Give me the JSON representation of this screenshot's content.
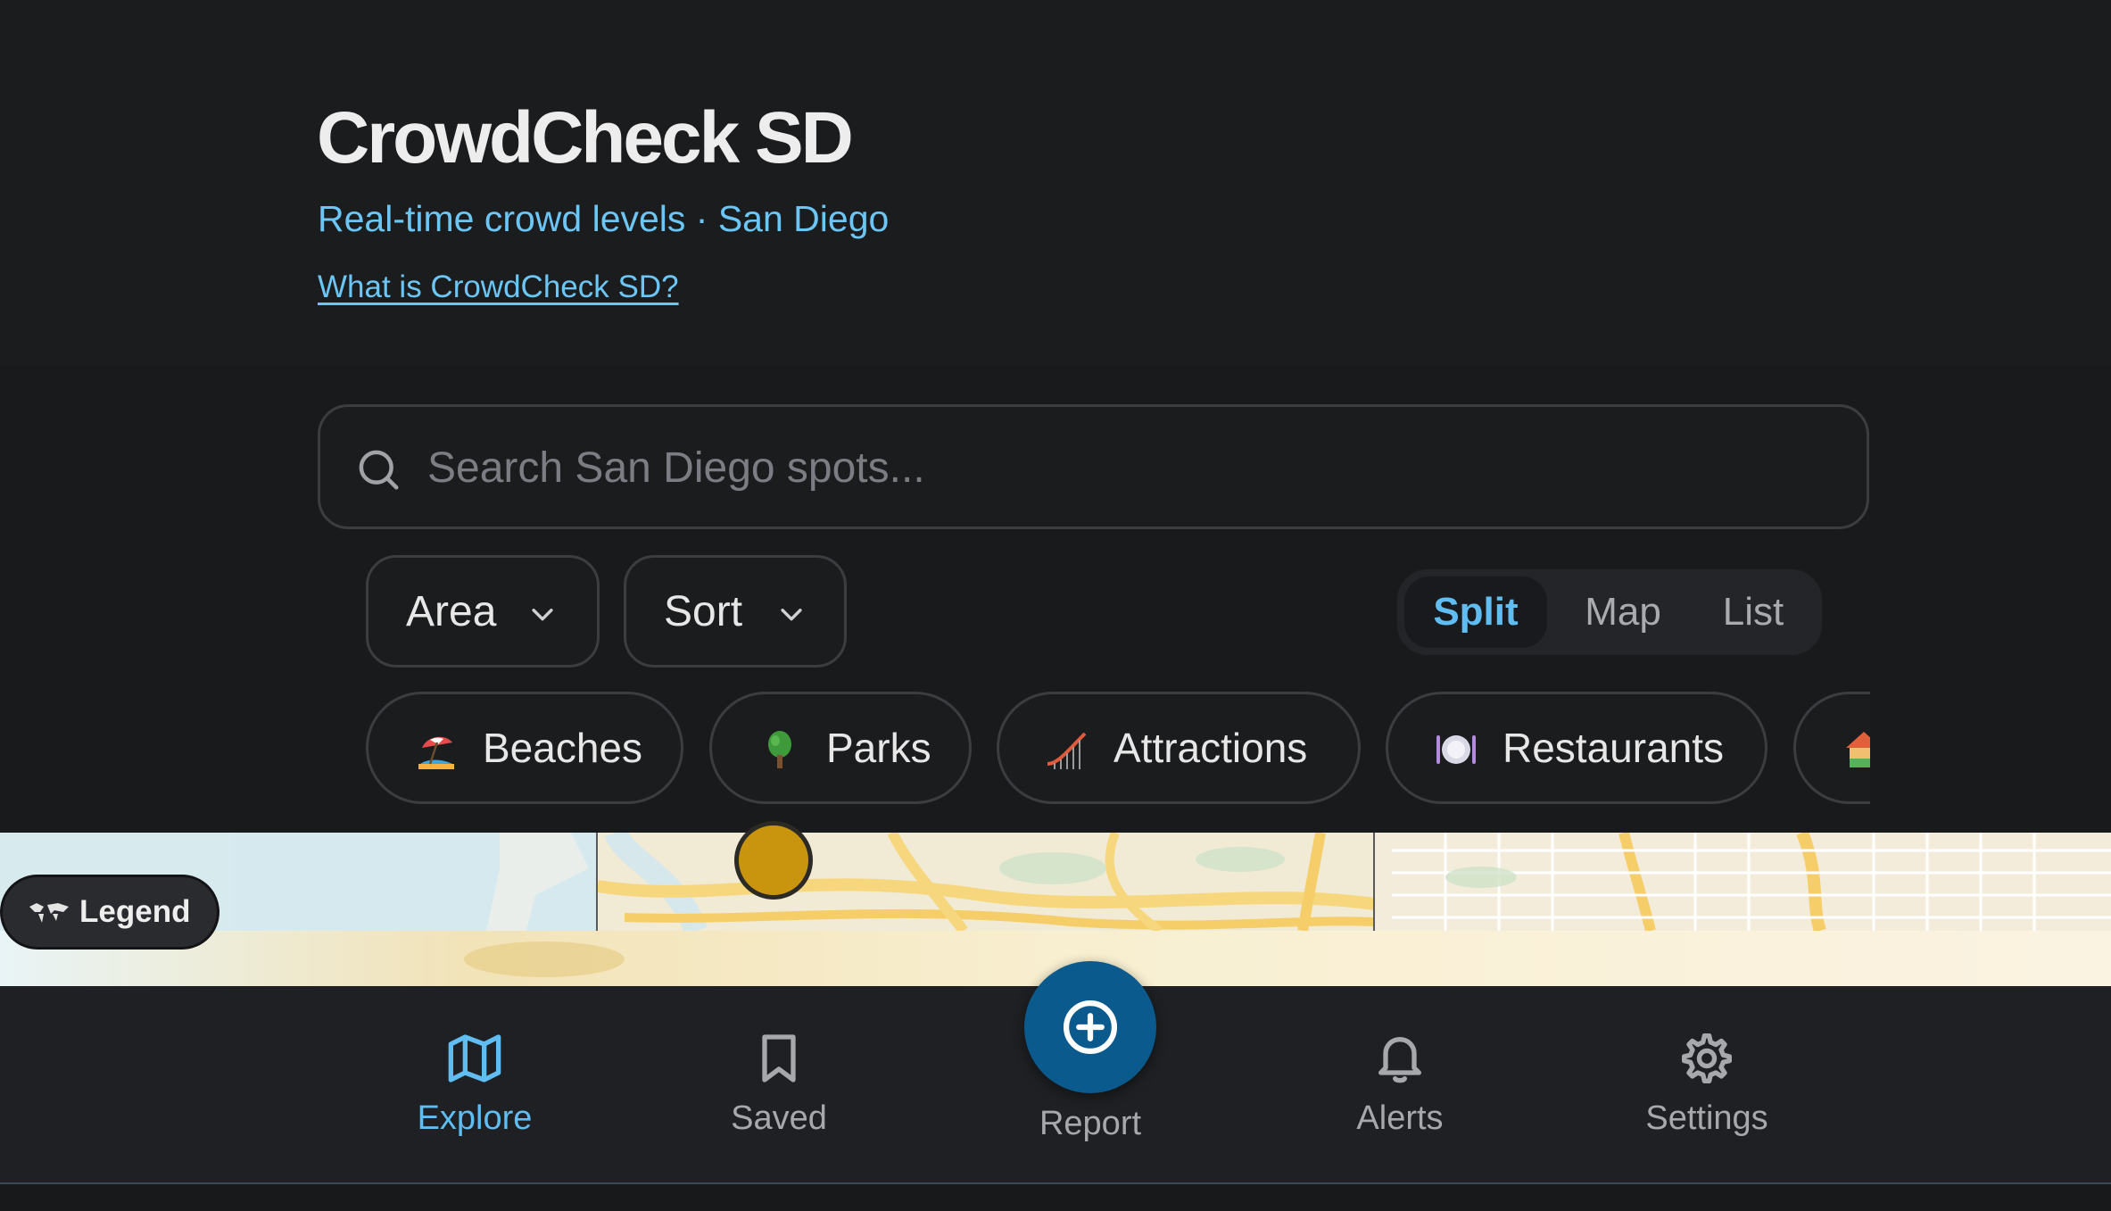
{
  "app": {
    "title": "CrowdCheck SD",
    "subtitle": "Real-time crowd levels · San Diego",
    "about_link": "What is CrowdCheck SD?"
  },
  "search": {
    "placeholder": "Search San Diego spots...",
    "value": ""
  },
  "filters": {
    "area_label": "Area",
    "sort_label": "Sort"
  },
  "view_toggle": {
    "options": [
      "Split",
      "Map",
      "List"
    ],
    "selected": "Split"
  },
  "categories": [
    {
      "label": "Beaches",
      "icon": "beach-umbrella-icon"
    },
    {
      "label": "Parks",
      "icon": "tree-icon"
    },
    {
      "label": "Attractions",
      "icon": "roller-coaster-icon"
    },
    {
      "label": "Restaurants",
      "icon": "plate-icon"
    },
    {
      "label": "",
      "icon": "house-icon"
    }
  ],
  "map": {
    "legend_label": "Legend",
    "pin_color": "#c9950e"
  },
  "bottom_nav": {
    "items": [
      {
        "label": "Explore",
        "icon": "map-icon",
        "active": true
      },
      {
        "label": "Saved",
        "icon": "bookmark-icon",
        "active": false
      },
      {
        "label": "Report",
        "icon": "plus-circle-icon",
        "active": false
      },
      {
        "label": "Alerts",
        "icon": "bell-icon",
        "active": false
      },
      {
        "label": "Settings",
        "icon": "gear-icon",
        "active": false
      }
    ]
  },
  "colors": {
    "accent": "#5fbdf2",
    "background": "#1b1c1e",
    "fab": "#0a5a8e"
  }
}
